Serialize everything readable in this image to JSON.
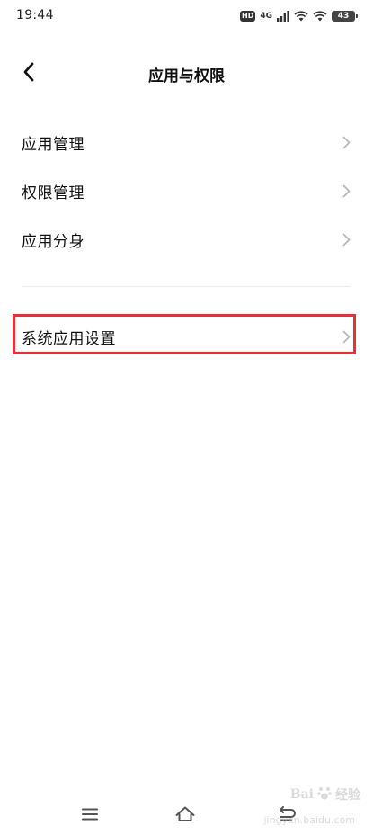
{
  "status_bar": {
    "time": "19:44",
    "hd_badge": "HD",
    "network": "4G",
    "battery": "43"
  },
  "header": {
    "title": "应用与权限",
    "back_icon": "chevron-left-icon"
  },
  "menu": {
    "items": [
      {
        "label": "应用管理",
        "icon": "chevron-right-icon"
      },
      {
        "label": "权限管理",
        "icon": "chevron-right-icon"
      },
      {
        "label": "应用分身",
        "icon": "chevron-right-icon"
      },
      {
        "label": "系统应用设置",
        "icon": "chevron-right-icon"
      }
    ]
  },
  "highlight": {
    "color": "#e8303a"
  },
  "nav_bar": {
    "icons": [
      "menu-icon",
      "home-icon",
      "back-icon"
    ]
  },
  "watermark": {
    "brand": "Bai",
    "brand_suffix": "经验",
    "sub": "jingyan.baidu.com"
  }
}
